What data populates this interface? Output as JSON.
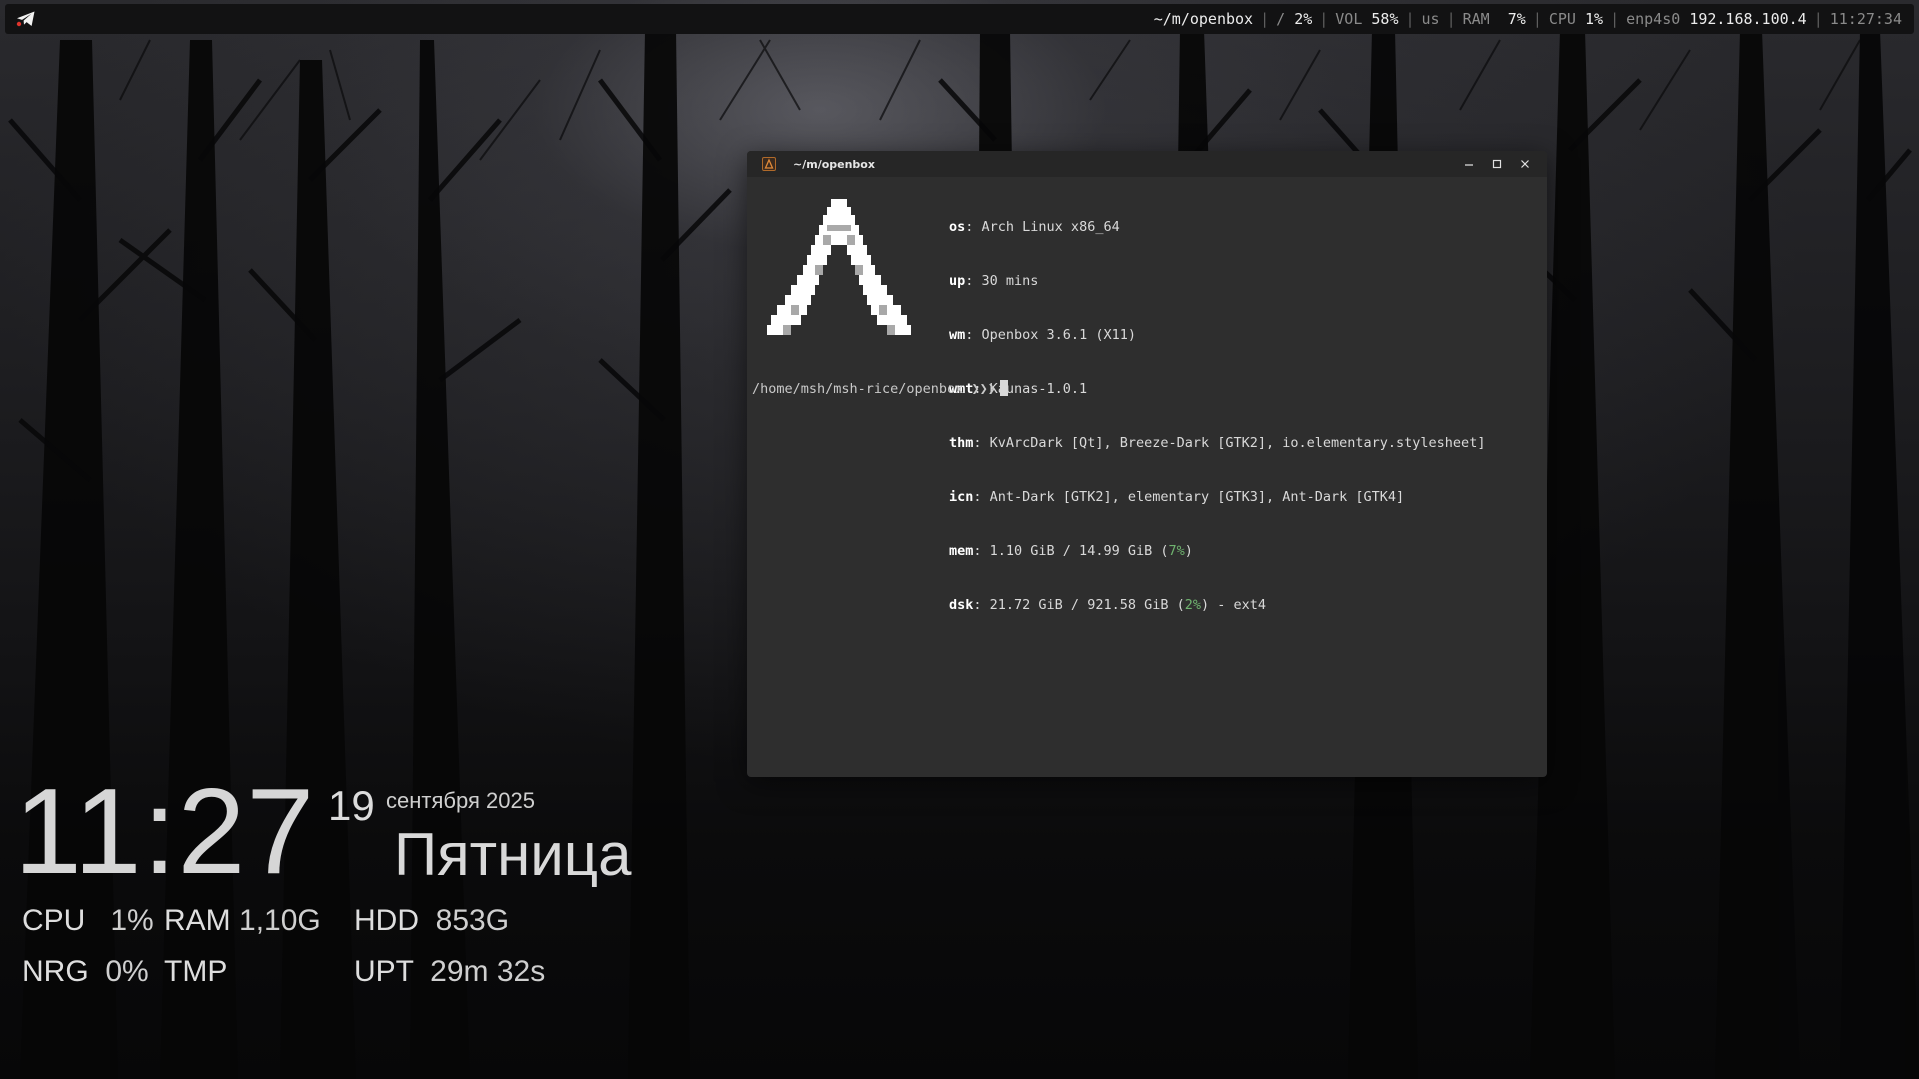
{
  "topbar": {
    "launcher_icon": "telegram-icon",
    "path": "~/m/openbox",
    "disk_label": "/",
    "disk_value": "2%",
    "vol_label": "VOL",
    "vol_value": "58%",
    "layout": "us",
    "ram_label": "RAM",
    "ram_value": "7%",
    "cpu_label": "CPU",
    "cpu_value": "1%",
    "net_iface": "enp4s0",
    "net_ip": "192.168.100.4",
    "time": "11:27:34",
    "separator": "|"
  },
  "terminal": {
    "title": "~/m/openbox",
    "icon": "terminal-icon",
    "controls": [
      "minimize-icon",
      "maximize-icon",
      "close-icon"
    ],
    "info": {
      "os_key": "os",
      "os_val": "Arch Linux x86_64",
      "up_key": "up",
      "up_val": "30 mins",
      "wm_key": "wm",
      "wm_val": "Openbox 3.6.1 (X11)",
      "wmt_key": "wmt",
      "wmt_val": "Kaunas-1.0.1",
      "thm_key": "thm",
      "thm_val": "KvArcDark [Qt], Breeze-Dark [GTK2], io.elementary.stylesheet]",
      "icn_key": "icn",
      "icn_val": "Ant-Dark [GTK2], elementary [GTK3], Ant-Dark [GTK4]",
      "mem_key": "mem",
      "mem_val": "1.10 GiB / 14.99 GiB (",
      "mem_pct": "7%",
      "mem_tail": ")",
      "dsk_key": "dsk",
      "dsk_val": "21.72 GiB / 921.58 GiB (",
      "dsk_pct": "2%",
      "dsk_tail": ") - ext4"
    },
    "prompt_path": "/home/msh/msh-rice/openbox",
    "prompt_symbol": "❯❯❯",
    "logo": "arch-linux-logo"
  },
  "conky": {
    "time": "11:27",
    "day": "19",
    "month_year": "сентября 2025",
    "weekday": "Пятница",
    "cpu_label": "CPU",
    "cpu_value": "1%",
    "ram_label": "RAM",
    "ram_value": "1,10G",
    "hdd_label": "HDD",
    "hdd_value": "853G",
    "nrg_label": "NRG",
    "nrg_value": "0%",
    "tmp_label": "TMP",
    "tmp_value": "",
    "upt_label": "UPT",
    "upt_value": "29m 32s"
  },
  "colors": {
    "bar_bg": "#121213",
    "terminal_bg": "#2e2e2e",
    "accent_green": "#6fb36f",
    "telegram_red": "#e0342c"
  }
}
